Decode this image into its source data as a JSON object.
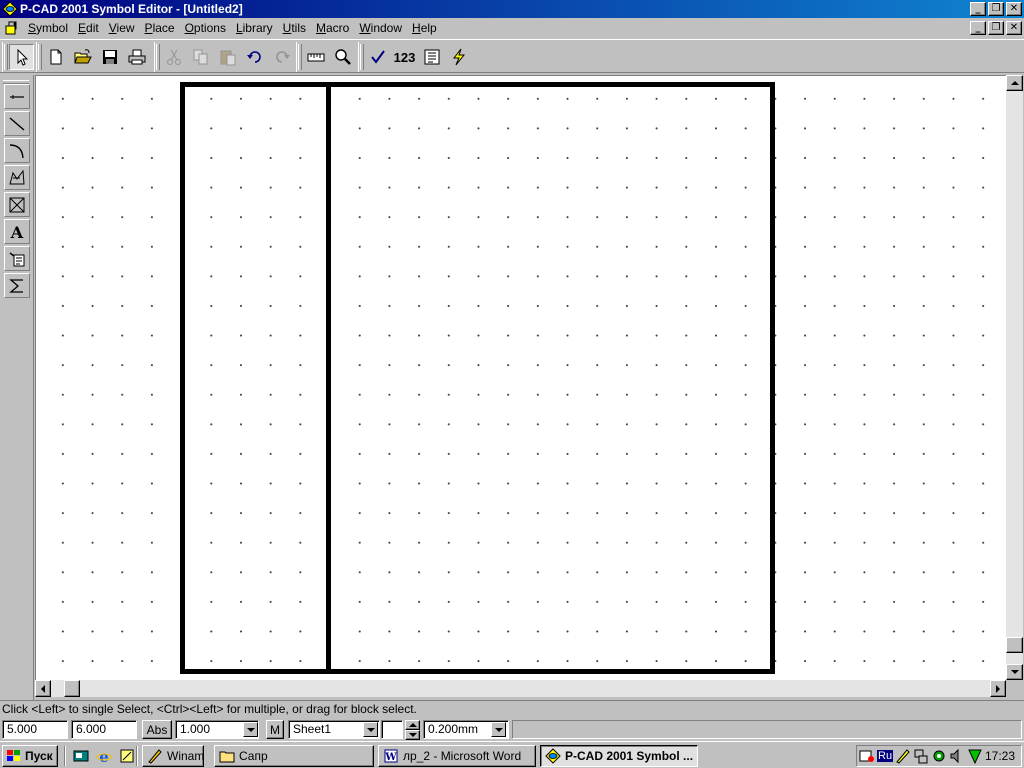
{
  "window": {
    "title": "P-CAD 2001 Symbol Editor - [Untitled2]",
    "min_glyph": "_",
    "restore_glyph": "❐",
    "close_glyph": "✕"
  },
  "menubar": {
    "items": [
      {
        "label": "Symbol",
        "accel": "S"
      },
      {
        "label": "Edit",
        "accel": "E"
      },
      {
        "label": "View",
        "accel": "V"
      },
      {
        "label": "Place",
        "accel": "P"
      },
      {
        "label": "Options",
        "accel": "O"
      },
      {
        "label": "Library",
        "accel": "L"
      },
      {
        "label": "Utils",
        "accel": "U"
      },
      {
        "label": "Macro",
        "accel": "M"
      },
      {
        "label": "Window",
        "accel": "W"
      },
      {
        "label": "Help",
        "accel": "H"
      }
    ]
  },
  "toolbar": {
    "buttons": [
      {
        "icon": "select-arrow-icon",
        "pressed": true
      },
      {
        "icon": "new-file-icon"
      },
      {
        "icon": "open-folder-icon"
      },
      {
        "icon": "save-disk-icon"
      },
      {
        "icon": "print-icon"
      },
      {
        "icon": "cut-icon",
        "disabled": true
      },
      {
        "icon": "copy-icon",
        "disabled": true
      },
      {
        "icon": "paste-icon",
        "disabled": true
      },
      {
        "icon": "undo-icon"
      },
      {
        "icon": "redo-icon",
        "disabled": true
      },
      {
        "icon": "ruler-icon"
      },
      {
        "icon": "zoom-icon"
      },
      {
        "icon": "validate-check-icon"
      },
      {
        "icon": "renumber-icon",
        "text": "123"
      },
      {
        "icon": "symbol-wizard-icon"
      },
      {
        "icon": "save-to-library-icon"
      }
    ]
  },
  "left_toolbar": {
    "tools": [
      {
        "icon": "place-pin-icon"
      },
      {
        "icon": "place-line-icon"
      },
      {
        "icon": "place-arc-icon"
      },
      {
        "icon": "place-polygon-icon"
      },
      {
        "icon": "place-ref-point-icon"
      },
      {
        "icon": "place-text-icon"
      },
      {
        "icon": "place-attribute-icon"
      },
      {
        "icon": "place-field-icon"
      }
    ]
  },
  "status": {
    "message": "Click <Left> to single Select, <Ctrl><Left> for multiple, or drag for block select.",
    "x": "5.000",
    "y": "6.000",
    "abs_label": "Abs",
    "grid": "1.000",
    "m_label": "M",
    "sheet": "Sheet1",
    "line_width": "0.200mm"
  },
  "taskbar": {
    "start_label": "Пуск",
    "tasks": [
      {
        "label": "Winamp",
        "icon": "winamp-icon"
      },
      {
        "label": "Сапр",
        "icon": "folder-icon"
      },
      {
        "label": "лр_2 - Microsoft Word",
        "icon": "word-icon"
      },
      {
        "label": "P-CAD 2001 Symbol ...",
        "icon": "pcad-icon",
        "active": true
      }
    ],
    "lang": "Ru",
    "clock": "17:23"
  },
  "colors": {
    "title_start": "#000080",
    "title_end": "#1084d0",
    "face": "#c0c0c0",
    "canvas": "#ffffff",
    "outline": "#000000"
  }
}
